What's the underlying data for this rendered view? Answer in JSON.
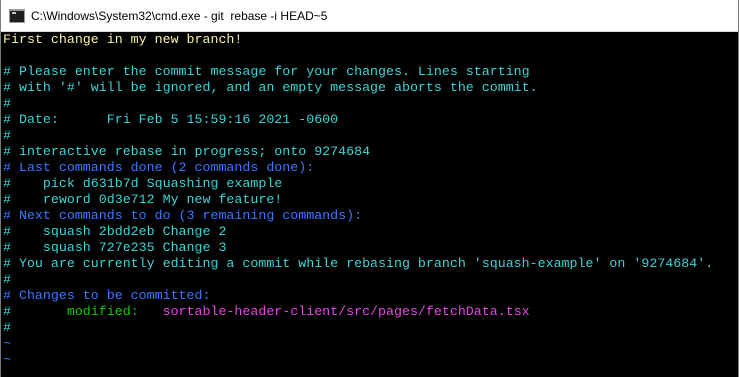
{
  "window": {
    "title": "C:\\Windows\\System32\\cmd.exe - git  rebase -i HEAD~5"
  },
  "terminal": {
    "lines": [
      {
        "segments": [
          {
            "text": "First change in my new branch!",
            "color": "yellow"
          }
        ]
      },
      {
        "segments": [
          {
            "text": "",
            "color": "cyan"
          }
        ]
      },
      {
        "segments": [
          {
            "text": "# Please enter the commit message for your changes. Lines starting",
            "color": "cyan"
          }
        ]
      },
      {
        "segments": [
          {
            "text": "# with '#' will be ignored, and an empty message aborts the commit.",
            "color": "cyan"
          }
        ]
      },
      {
        "segments": [
          {
            "text": "#",
            "color": "cyan"
          }
        ]
      },
      {
        "segments": [
          {
            "text": "# Date:      Fri Feb 5 15:59:16 2021 -0600",
            "color": "cyan"
          }
        ]
      },
      {
        "segments": [
          {
            "text": "#",
            "color": "cyan"
          }
        ]
      },
      {
        "segments": [
          {
            "text": "# interactive rebase in progress; onto 9274684",
            "color": "cyan"
          }
        ]
      },
      {
        "segments": [
          {
            "text": "# Last commands done (2 commands done):",
            "color": "blue"
          }
        ]
      },
      {
        "segments": [
          {
            "text": "#    pick d631b7d Squashing example",
            "color": "cyan"
          }
        ]
      },
      {
        "segments": [
          {
            "text": "#    reword 0d3e712 My new feature!",
            "color": "cyan"
          }
        ]
      },
      {
        "segments": [
          {
            "text": "# Next commands to do (3 remaining commands):",
            "color": "blue"
          }
        ]
      },
      {
        "segments": [
          {
            "text": "#    squash 2bdd2eb Change 2",
            "color": "cyan"
          }
        ]
      },
      {
        "segments": [
          {
            "text": "#    squash 727e235 Change 3",
            "color": "cyan"
          }
        ]
      },
      {
        "segments": [
          {
            "text": "# You are currently editing a commit while rebasing branch 'squash-example' on '9274684'.",
            "color": "cyan"
          }
        ]
      },
      {
        "segments": [
          {
            "text": "#",
            "color": "cyan"
          }
        ]
      },
      {
        "segments": [
          {
            "text": "# Changes to be committed:",
            "color": "blue"
          }
        ]
      },
      {
        "segments": [
          {
            "text": "#",
            "color": "cyan"
          },
          {
            "text": "       modified:   ",
            "color": "green"
          },
          {
            "text": "sortable-header-client/src/pages/fetchData.tsx",
            "color": "magenta"
          }
        ]
      },
      {
        "segments": [
          {
            "text": "#",
            "color": "cyan"
          }
        ]
      },
      {
        "segments": [
          {
            "text": "~",
            "color": "tilde"
          }
        ]
      },
      {
        "segments": [
          {
            "text": "~",
            "color": "tilde"
          }
        ]
      }
    ]
  },
  "colors": {
    "background": "#000000",
    "yellow": "#f9f1a5",
    "cyan": "#3ed2d6",
    "blue": "#3b78ff",
    "green": "#16c60c",
    "magenta": "#e546e5",
    "tilde": "#3b78ff"
  },
  "icons": {
    "title_icon": "cmd-console-icon"
  }
}
